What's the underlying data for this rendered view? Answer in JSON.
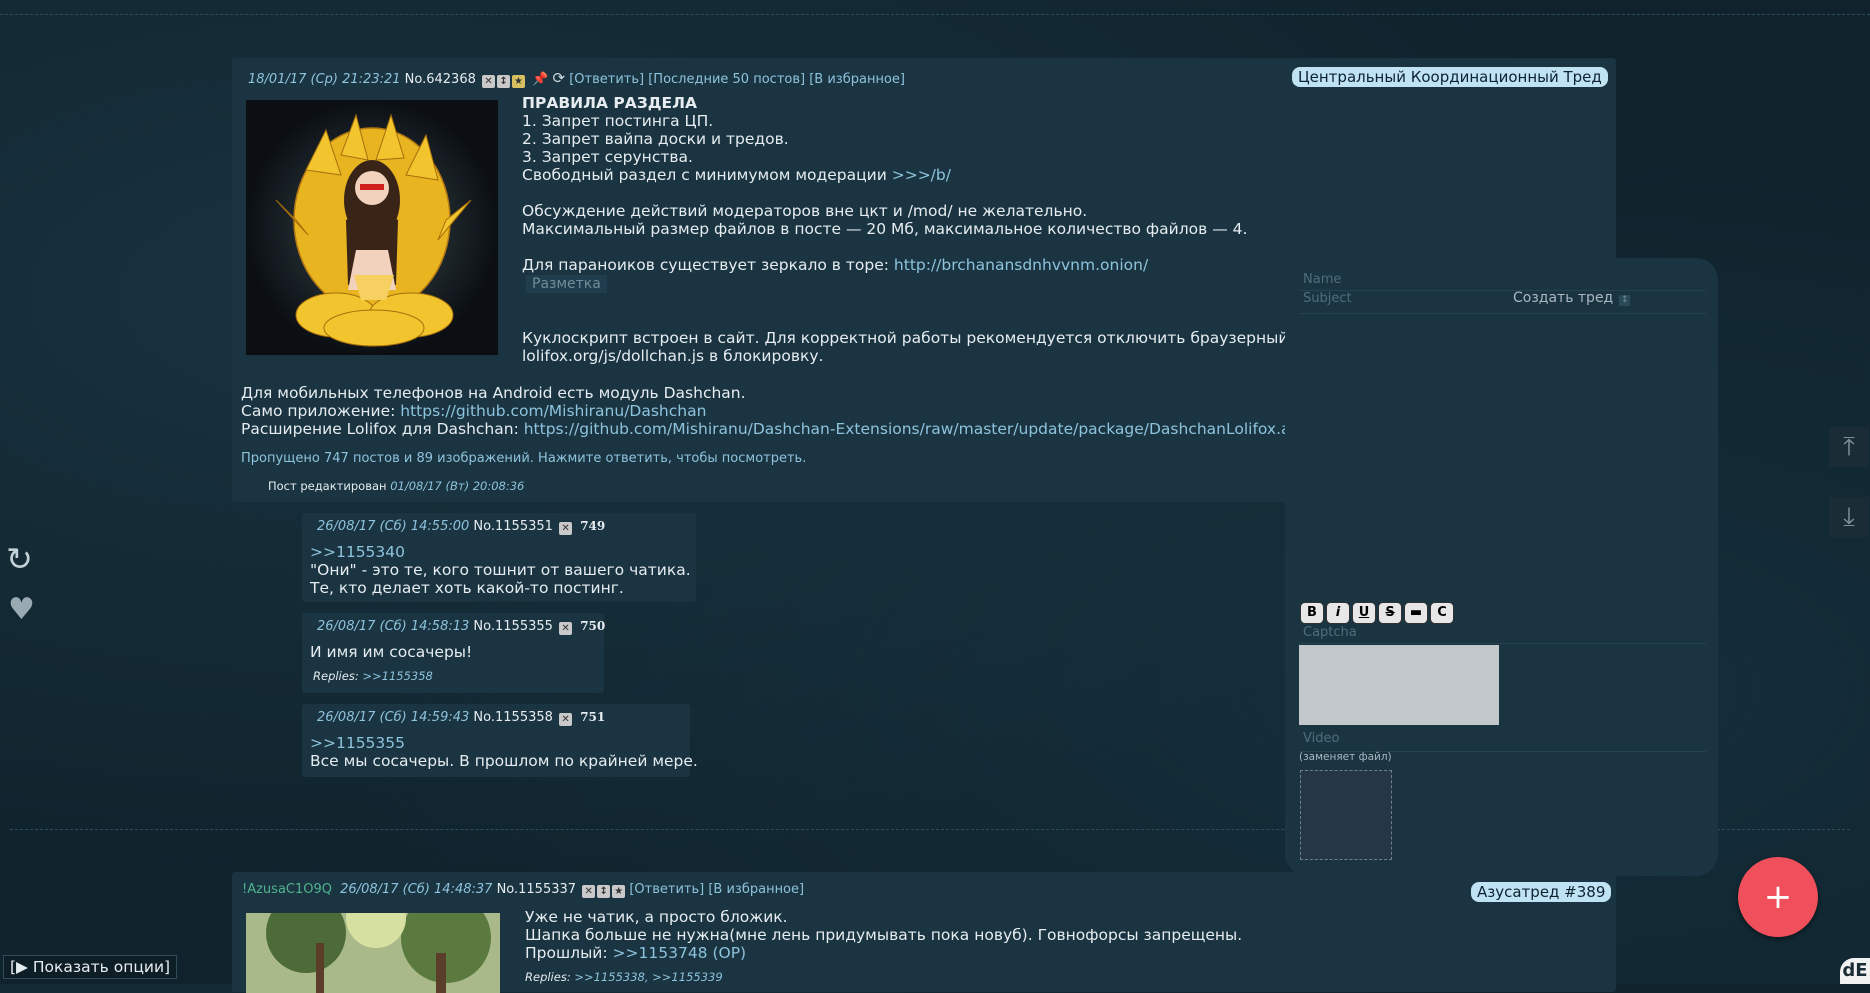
{
  "thread1": {
    "date": "18/01/17 (Ср) 21:23:21",
    "num": "No.642368",
    "links": [
      "[Ответить]",
      "[Последние 50 постов]",
      "[В избранное]"
    ],
    "subject": "Центральный Координационный Тред",
    "rules_title": "ПРАВИЛА РАЗДЕЛА",
    "rule1": "1. Запрет постинга ЦП.",
    "rule2": "2. Запрет вайпа доски и тредов.",
    "rule3": "3. Запрет серунства.",
    "free_text": "Свободный раздел с минимумом модерации ",
    "free_link": ">>>/b/",
    "mod_line": "Обсуждение действий модераторов вне цкт и /mod/ не желательно.",
    "size_line": "Максимальный размер файлов в посте — 20 Мб, максимальное количество файлов — 4.",
    "mirror_text": "Для параноиков существует зеркало в торе: ",
    "mirror_link": "http://brchanansdnhvvnm.onion/",
    "markup_label": "Разметка",
    "kukla1": "Куклоскрипт встроен в сайт. Для корректной работы рекомендуется отключить браузерный.",
    "kukla2": "lolifox.org/js/dollchan.js в блокировку.",
    "android_line": "Для мобильных телефонов на Android есть модуль Dashchan.",
    "app_label": "Само приложение: ",
    "app_link": "https://github.com/Mishiranu/Dashchan",
    "ext_label": "Расширение Lolifox для Dashchan: ",
    "ext_link": "https://github.com/Mishiranu/Dashchan-Extensions/raw/master/update/package/DashchanLolifox.a",
    "omitted": "Пропущено 747 постов и 89 изображений. Нажмите ответить, чтобы посмотреть.",
    "edited_label": "Пост редактирован ",
    "edited_date": "01/08/17 (Вт) 20:08:36"
  },
  "replies": [
    {
      "date": "26/08/17 (Сб) 14:55:00",
      "num": "No.1155351",
      "count": "749",
      "quote": ">>1155340",
      "line1": "\"Они\" - это те, кого тошнит от вашего чатика.",
      "line2": "Те, кто делает хоть какой-то постинг."
    },
    {
      "date": "26/08/17 (Сб) 14:58:13",
      "num": "No.1155355",
      "count": "750",
      "line1": "И имя им сосачеры!",
      "replies_label": "Replies: ",
      "replies_link": ">>1155358"
    },
    {
      "date": "26/08/17 (Сб) 14:59:43",
      "num": "No.1155358",
      "count": "751",
      "quote": ">>1155355",
      "line1": "Все мы сосачеры. В прошлом по крайней мере."
    }
  ],
  "form": {
    "name_ph": "Name",
    "subject_ph": "Subject",
    "create_btn": "Создать тред",
    "arrow": "↕",
    "toolbar": [
      "B",
      "i",
      "U",
      "S",
      "▬",
      "C"
    ],
    "captcha_label": "Captcha",
    "video_label": "Video",
    "video_hint": "(заменяет файл)"
  },
  "thread2": {
    "trip": "!AzusaC1O9Q",
    "date": "26/08/17 (Сб) 14:48:37",
    "num": "No.1155337",
    "links": [
      "[Ответить]",
      "[В избранное]"
    ],
    "subject": "Азусатред #389",
    "line1": "Уже не чатик, а просто бложик.",
    "line2": "Шапка больше не нужна(мне лень придумывать пока новуб). Говнофорсы запрещены.",
    "prev_label": "Прошлый: ",
    "prev_link": ">>1153748 (OP)",
    "replies_label": "Replies: ",
    "replies_links": ">>1155338, >>1155339"
  },
  "ui": {
    "show_options": "[▶ Показать опции]",
    "fab": "+",
    "refresh": "↻",
    "heart": "♥",
    "up": "⤒",
    "down": "⤓",
    "logo": "dE"
  }
}
